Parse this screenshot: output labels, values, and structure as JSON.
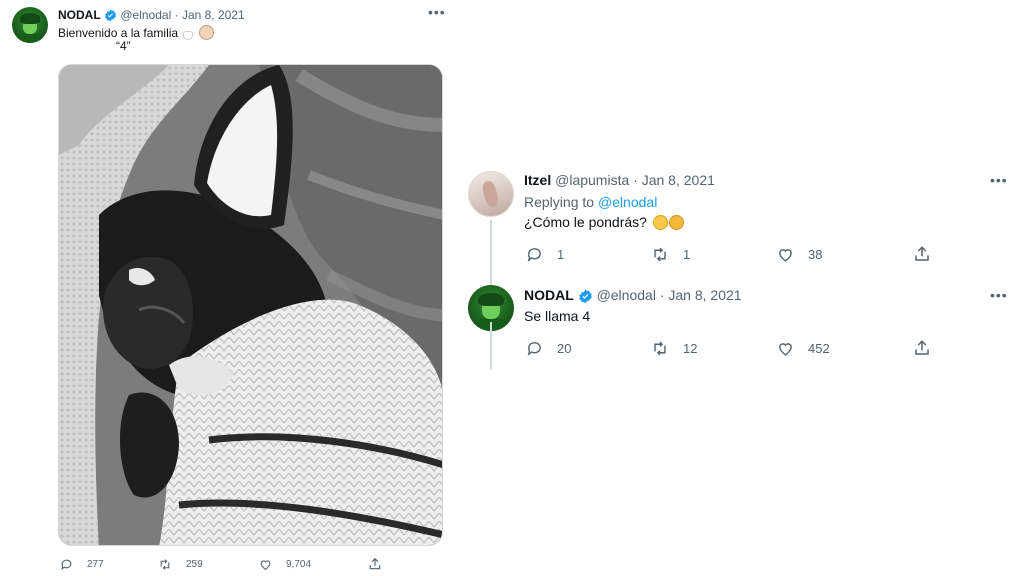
{
  "main_tweet": {
    "author_name": "NODAL",
    "handle": "@elnodal",
    "date": "Jan 8, 2021",
    "separator": "·",
    "text_line1": "Bienvenido a la familia",
    "text_line2": "“4”",
    "more_icon": "more-horizontal-icon",
    "actions": {
      "replies": "277",
      "retweets": "259",
      "likes": "9,704"
    }
  },
  "replies": [
    {
      "author_name": "Itzel",
      "handle": "@lapumista",
      "date": "Jan 8, 2021",
      "replying_prefix": "Replying to",
      "replying_to": "@elnodal",
      "text": "¿Cómo le pondrás?",
      "actions": {
        "replies": "1",
        "retweets": "1",
        "likes": "38"
      }
    },
    {
      "author_name": "NODAL",
      "handle": "@elnodal",
      "date": "Jan 8, 2021",
      "text": "Se llama 4",
      "actions": {
        "replies": "20",
        "retweets": "12",
        "likes": "452"
      }
    }
  ],
  "colors": {
    "verified": "#1d9bf0",
    "link": "#1d9bf0",
    "muted": "#536471"
  }
}
